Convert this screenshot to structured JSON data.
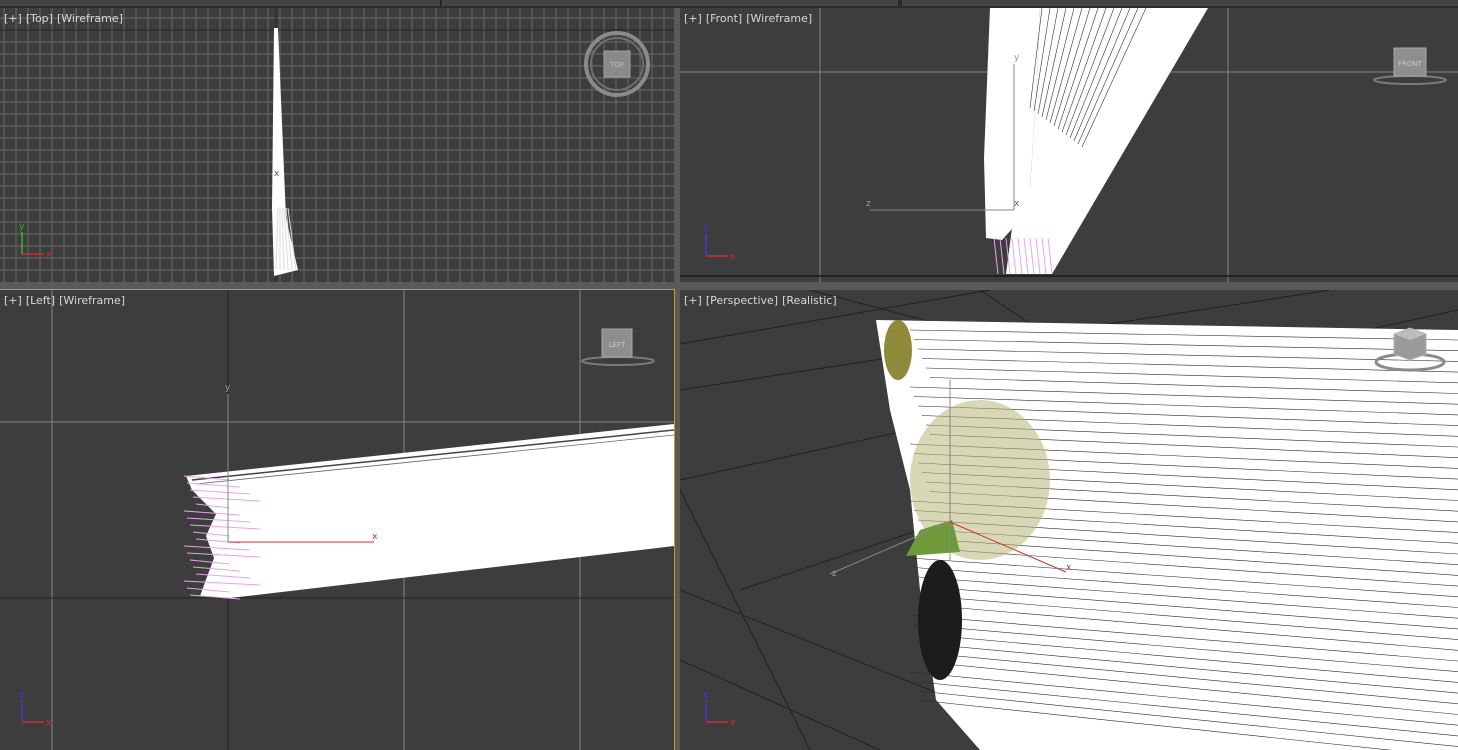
{
  "viewports": {
    "top": {
      "plus": "[+]",
      "view": "[Top]",
      "shading": "[Wireframe]",
      "cube_label": "TOP"
    },
    "front": {
      "plus": "[+]",
      "view": "[Front]",
      "shading": "[Wireframe]",
      "cube_label": "FRONT"
    },
    "left": {
      "plus": "[+]",
      "view": "[Left]",
      "shading": "[Wireframe]",
      "cube_label": "LEFT"
    },
    "perspective": {
      "plus": "[+]",
      "view": "[Perspective]",
      "shading": "[Realistic]"
    }
  },
  "axes": {
    "x": "x",
    "y": "y",
    "z": "z"
  },
  "colors": {
    "viewport_bg": "#3d3d3d",
    "grid_minor": "#6a6a6a",
    "grid_major": "#858585",
    "active_border": "#b79b52",
    "axis_x": "#c83232",
    "axis_y": "#32b432",
    "axis_z": "#3c3cd2",
    "hair_tip": "#e6a6e6",
    "hair": "#ffffff"
  }
}
